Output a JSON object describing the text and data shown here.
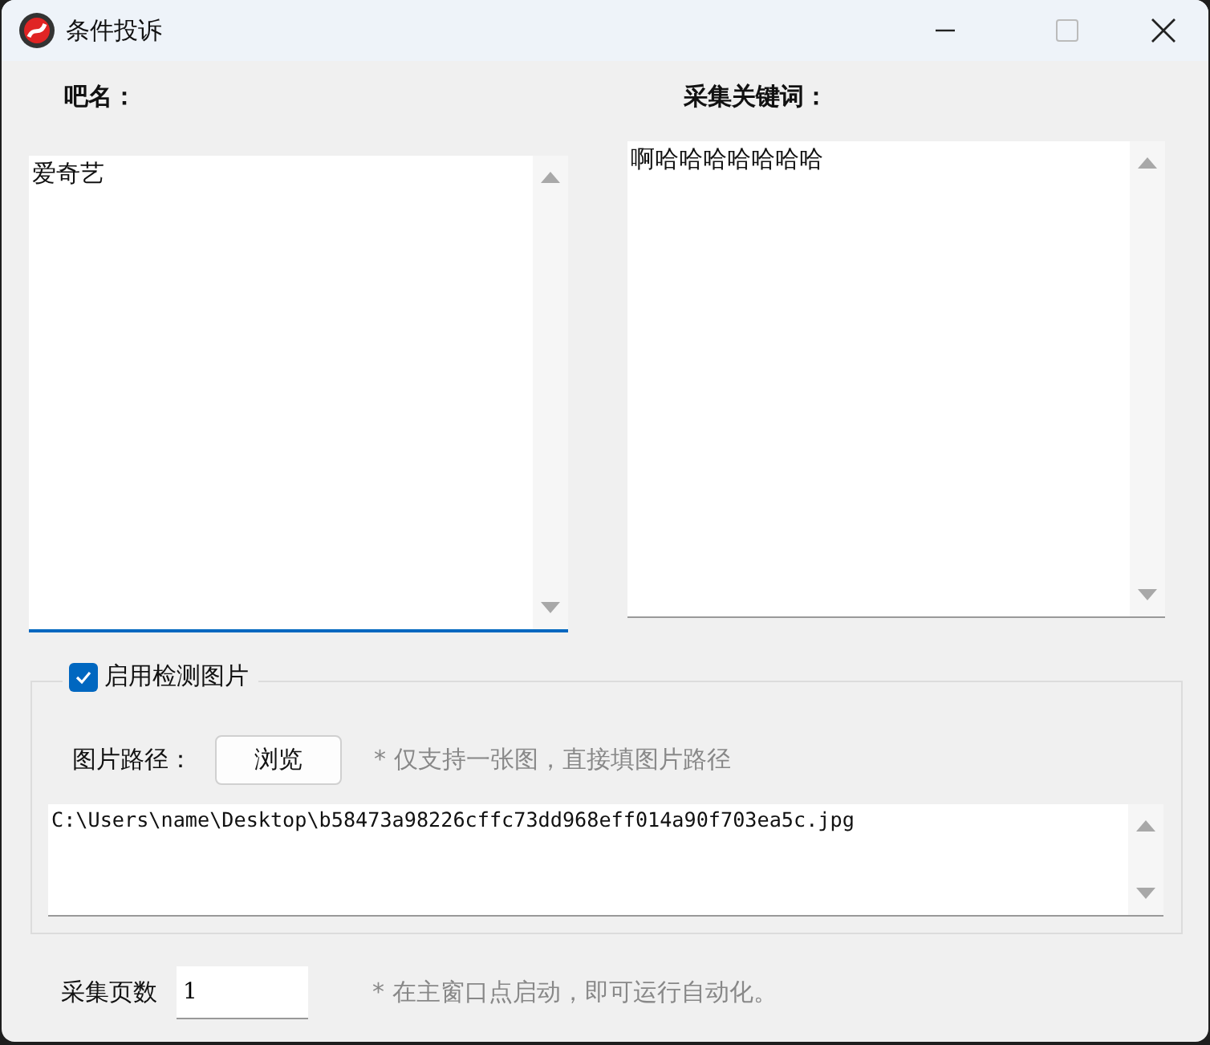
{
  "window": {
    "title": "条件投诉"
  },
  "name_label": "吧名：",
  "name_field": {
    "value": "爱奇艺",
    "focused": true
  },
  "keywords_label": "采集关键词：",
  "keywords_field": {
    "value": "啊哈哈哈哈哈哈哈",
    "focused": false
  },
  "image_group": {
    "checkbox": {
      "label": "启用检测图片",
      "checked": true
    },
    "path_label": "图片路径：",
    "browse_button": "浏览",
    "hint": "* 仅支持一张图，直接填图片路径",
    "path_field": {
      "value": "C:\\Users\\name\\Desktop\\b58473a98226cffc73dd968eff014a90f703ea5c.jpg"
    }
  },
  "pages": {
    "label": "采集页数",
    "value": "1",
    "hint": "* 在主窗口点启动，即可运行自动化。"
  }
}
